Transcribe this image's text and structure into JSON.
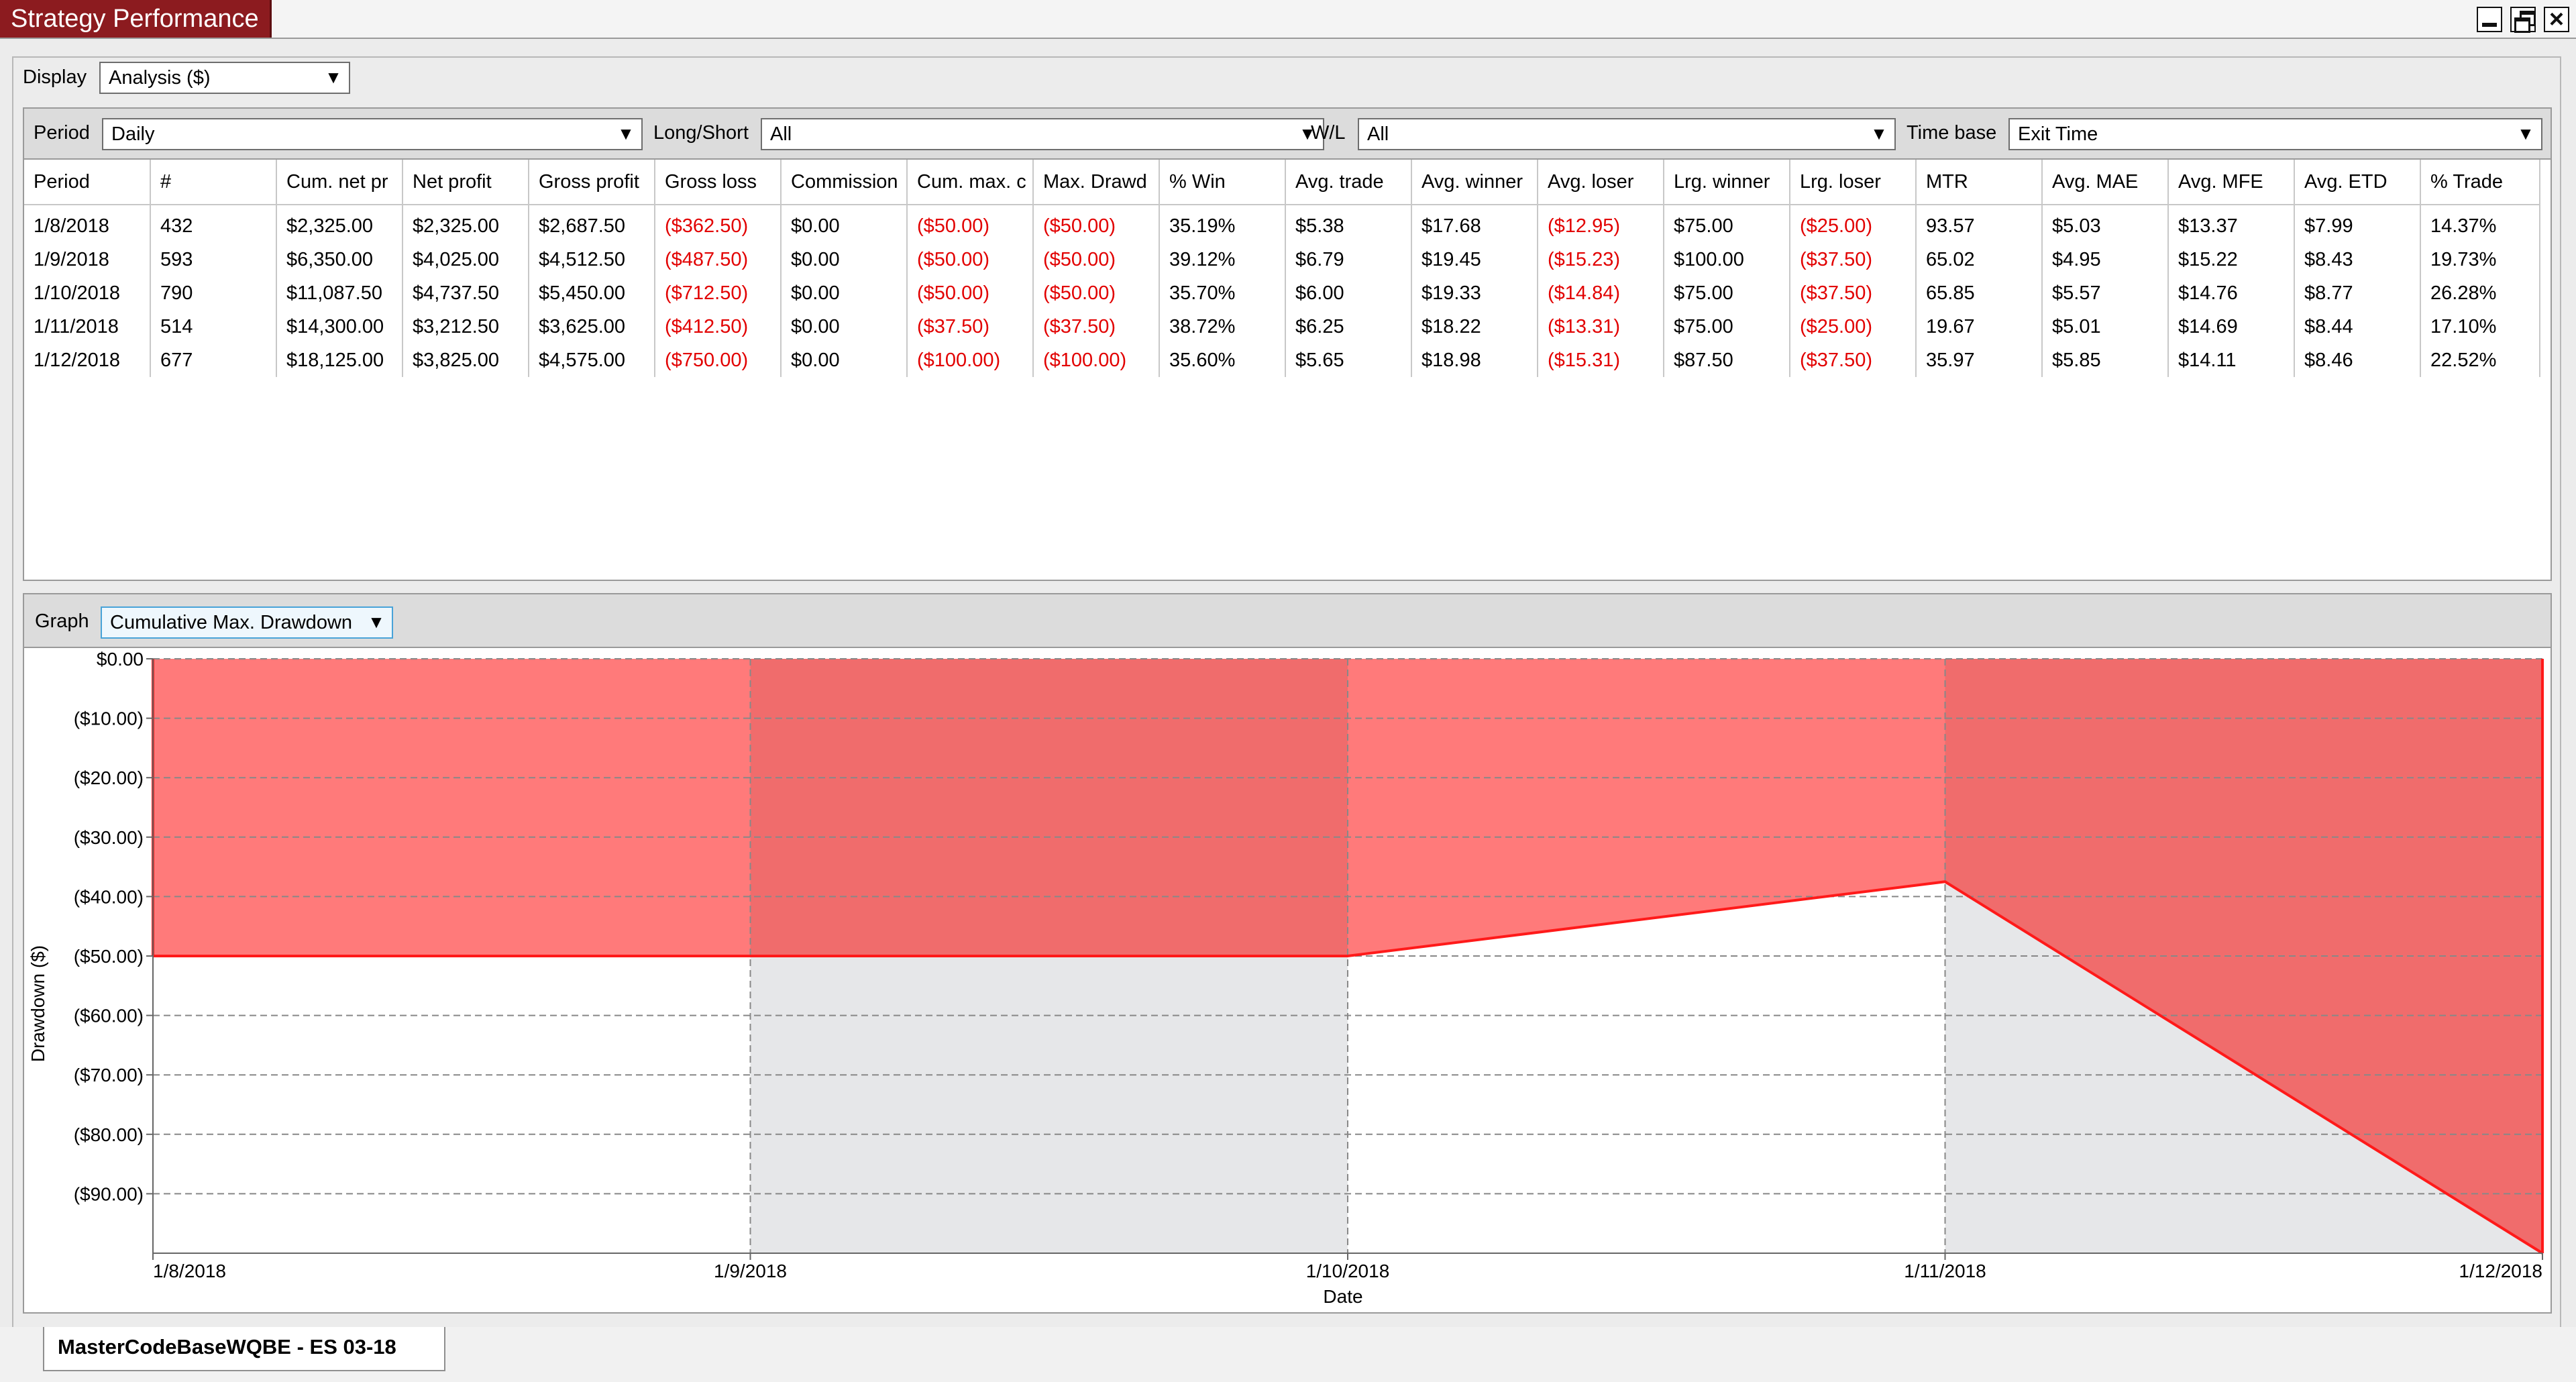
{
  "window": {
    "title": "Strategy Performance"
  },
  "display": {
    "label": "Display",
    "value": "Analysis ($)"
  },
  "filters": {
    "period": {
      "label": "Period",
      "value": "Daily"
    },
    "long_short": {
      "label": "Long/Short",
      "value": "All"
    },
    "wl": {
      "label": "W/L",
      "value": "All"
    },
    "time_base": {
      "label": "Time base",
      "value": "Exit Time"
    }
  },
  "table": {
    "columns": [
      "Period",
      "#",
      "Cum. net pr",
      "Net profit",
      "Gross profit",
      "Gross loss",
      "Commission",
      "Cum. max. c",
      "Max. Drawd",
      "% Win",
      "Avg. trade",
      "Avg. winner",
      "Avg. loser",
      "Lrg. winner",
      "Lrg. loser",
      "MTR",
      "Avg. MAE",
      "Avg. MFE",
      "Avg. ETD",
      "% Trade"
    ],
    "rows": [
      [
        "1/8/2018",
        "432",
        "$2,325.00",
        "$2,325.00",
        "$2,687.50",
        "($362.50)",
        "$0.00",
        "($50.00)",
        "($50.00)",
        "35.19%",
        "$5.38",
        "$17.68",
        "($12.95)",
        "$75.00",
        "($25.00)",
        "93.57",
        "$5.03",
        "$13.37",
        "$7.99",
        "14.37%"
      ],
      [
        "1/9/2018",
        "593",
        "$6,350.00",
        "$4,025.00",
        "$4,512.50",
        "($487.50)",
        "$0.00",
        "($50.00)",
        "($50.00)",
        "39.12%",
        "$6.79",
        "$19.45",
        "($15.23)",
        "$100.00",
        "($37.50)",
        "65.02",
        "$4.95",
        "$15.22",
        "$8.43",
        "19.73%"
      ],
      [
        "1/10/2018",
        "790",
        "$11,087.50",
        "$4,737.50",
        "$5,450.00",
        "($712.50)",
        "$0.00",
        "($50.00)",
        "($50.00)",
        "35.70%",
        "$6.00",
        "$19.33",
        "($14.84)",
        "$75.00",
        "($37.50)",
        "65.85",
        "$5.57",
        "$14.76",
        "$8.77",
        "26.28%"
      ],
      [
        "1/11/2018",
        "514",
        "$14,300.00",
        "$3,212.50",
        "$3,625.00",
        "($412.50)",
        "$0.00",
        "($37.50)",
        "($37.50)",
        "38.72%",
        "$6.25",
        "$18.22",
        "($13.31)",
        "$75.00",
        "($25.00)",
        "19.67",
        "$5.01",
        "$14.69",
        "$8.44",
        "17.10%"
      ],
      [
        "1/12/2018",
        "677",
        "$18,125.00",
        "$3,825.00",
        "$4,575.00",
        "($750.00)",
        "$0.00",
        "($100.00)",
        "($100.00)",
        "35.60%",
        "$5.65",
        "$18.98",
        "($15.31)",
        "$87.50",
        "($37.50)",
        "35.97",
        "$5.85",
        "$14.11",
        "$8.46",
        "22.52%"
      ]
    ]
  },
  "graph": {
    "label": "Graph",
    "value": "Cumulative Max. Drawdown"
  },
  "chart_data": {
    "type": "area",
    "x": [
      "1/8/2018",
      "1/9/2018",
      "1/10/2018",
      "1/11/2018",
      "1/12/2018"
    ],
    "values": [
      -50,
      -50,
      -50,
      -37.5,
      -100
    ],
    "xlabel": "Date",
    "ylabel": "Drawdown ($)",
    "ylim": [
      -100,
      0
    ],
    "yticks": [
      "$0.00",
      "($10.00)",
      "($20.00)",
      "($30.00)",
      "($40.00)",
      "($50.00)",
      "($60.00)",
      "($70.00)",
      "($80.00)",
      "($90.00)"
    ],
    "grid": true,
    "colors": {
      "fill": "#ff7a7a",
      "fill_alt": "#f06c6c",
      "line": "#ff1a1a",
      "band_alt": "#e6e7e9",
      "grid": "#888888"
    }
  },
  "bottom_tab": {
    "label": "MasterCodeBaseWQBE - ES 03-18"
  }
}
